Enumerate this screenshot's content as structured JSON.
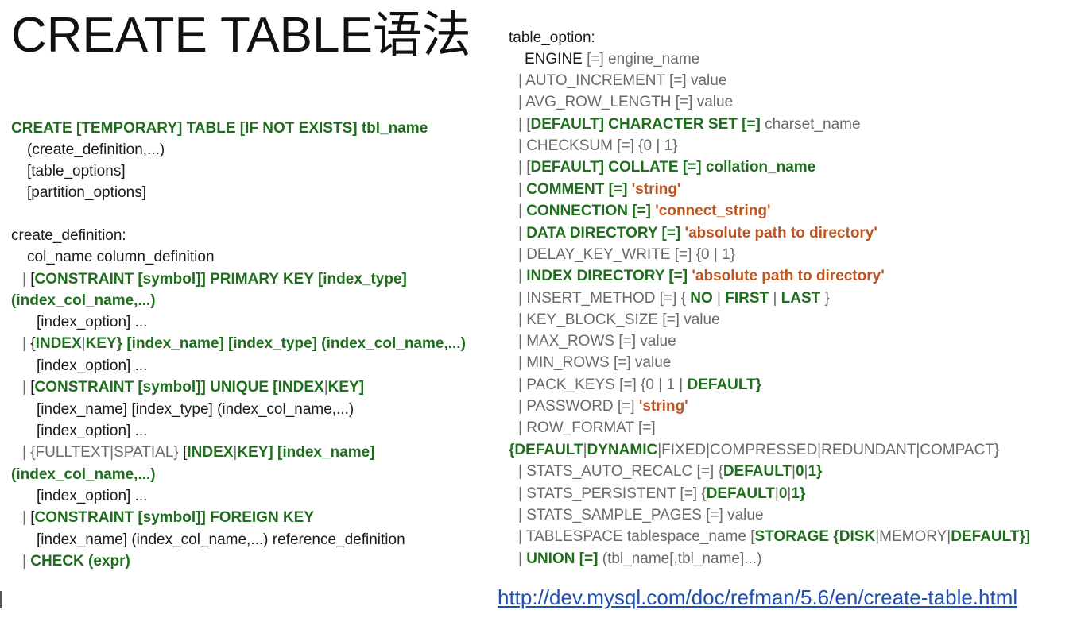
{
  "title": "CREATE TABLE语法",
  "colors": {
    "keyword": "#1e6e1e",
    "option": "#6a6a6a",
    "string": "#c0531e",
    "link": "#1f4fb4"
  },
  "left_lines": [
    [
      [
        "k",
        "CREATE [TEMPORARY] TABLE [IF NOT EXISTS] tbl_name"
      ]
    ],
    [
      [
        "d",
        "(create_definition,...)"
      ]
    ],
    [
      [
        "d",
        "[table_options]"
      ]
    ],
    [
      [
        "d",
        "[partition_options]"
      ]
    ],
    [
      [
        "d",
        "create_definition:"
      ]
    ],
    [
      [
        "d",
        "col_name column_definition"
      ]
    ],
    [
      [
        "g",
        "| "
      ],
      [
        "d",
        "["
      ],
      [
        "k",
        "CONSTRAINT [symbol]] PRIMARY KEY [index_type]"
      ]
    ],
    [
      [
        "k",
        "(index_col_name,...)"
      ]
    ],
    [
      [
        "d",
        "[index_option] ..."
      ]
    ],
    [
      [
        "g",
        "| "
      ],
      [
        "d",
        "{"
      ],
      [
        "k",
        "INDEX"
      ],
      [
        "g",
        "|"
      ],
      [
        "k",
        "KEY} [index_name] [index_type] (index_col_name,...)"
      ]
    ],
    [
      [
        "d",
        "[index_option] ..."
      ]
    ],
    [
      [
        "g",
        "| "
      ],
      [
        "d",
        "["
      ],
      [
        "k",
        "CONSTRAINT [symbol]] UNIQUE [INDEX"
      ],
      [
        "g",
        "|"
      ],
      [
        "k",
        "KEY]"
      ]
    ],
    [
      [
        "d",
        "[index_name] [index_type] (index_col_name,...)"
      ]
    ],
    [
      [
        "d",
        "[index_option] ..."
      ]
    ],
    [
      [
        "g",
        "| {FULLTEXT|SPATIAL} "
      ],
      [
        "d",
        "["
      ],
      [
        "k",
        "INDEX"
      ],
      [
        "g",
        "|"
      ],
      [
        "k",
        "KEY] [index_name]"
      ]
    ],
    [
      [
        "k",
        "(index_col_name,...)"
      ]
    ],
    [
      [
        "d",
        "[index_option] ..."
      ]
    ],
    [
      [
        "g",
        "| "
      ],
      [
        "d",
        "["
      ],
      [
        "k",
        "CONSTRAINT [symbol]] FOREIGN KEY"
      ]
    ],
    [
      [
        "d",
        "[index_name] (index_col_name,...) reference_definition"
      ]
    ],
    [
      [
        "g",
        "| "
      ],
      [
        "k",
        "CHECK (expr)"
      ]
    ]
  ],
  "right_lines": [
    [
      [
        "d",
        "table_option:"
      ]
    ],
    [
      [
        "d",
        "ENGINE "
      ],
      [
        "g",
        "[=] engine_name"
      ]
    ],
    [
      [
        "g",
        "| AUTO_INCREMENT [=] value"
      ]
    ],
    [
      [
        "g",
        "| AVG_ROW_LENGTH [=] value"
      ]
    ],
    [
      [
        "g",
        "| ["
      ],
      [
        "k",
        "DEFAULT] CHARACTER SET [=] "
      ],
      [
        "g",
        "charset_name"
      ]
    ],
    [
      [
        "g",
        "| CHECKSUM [=] {0 | 1}"
      ]
    ],
    [
      [
        "g",
        "| ["
      ],
      [
        "k",
        "DEFAULT] COLLATE [=] collation_name"
      ]
    ],
    [
      [
        "g",
        "| "
      ],
      [
        "k",
        "COMMENT [=] "
      ],
      [
        "o",
        "'string'"
      ]
    ],
    [
      [
        "g",
        "| "
      ],
      [
        "k",
        "CONNECTION [=] "
      ],
      [
        "o",
        "'connect_string'"
      ]
    ],
    [
      [
        "g",
        "| "
      ],
      [
        "k",
        "DATA DIRECTORY [=] "
      ],
      [
        "o",
        "'absolute path to directory'"
      ]
    ],
    [
      [
        "g",
        "| DELAY_KEY_WRITE [=] {0 | 1}"
      ]
    ],
    [
      [
        "g",
        "| "
      ],
      [
        "k",
        "INDEX DIRECTORY [=] "
      ],
      [
        "o",
        "'absolute path to directory'"
      ]
    ],
    [
      [
        "g",
        "| INSERT_METHOD [=] { "
      ],
      [
        "k",
        "NO"
      ],
      [
        "g",
        " | "
      ],
      [
        "k",
        "FIRST"
      ],
      [
        "g",
        " | "
      ],
      [
        "k",
        "LAST"
      ],
      [
        "g",
        " }"
      ]
    ],
    [
      [
        "g",
        "| KEY_BLOCK_SIZE [=] value"
      ]
    ],
    [
      [
        "g",
        "| MAX_ROWS [=] value"
      ]
    ],
    [
      [
        "g",
        "| MIN_ROWS [=] value"
      ]
    ],
    [
      [
        "g",
        "| PACK_KEYS [=] {0 | 1 | "
      ],
      [
        "k",
        "DEFAULT}"
      ]
    ],
    [
      [
        "g",
        "| PASSWORD [=] "
      ],
      [
        "o",
        "'string'"
      ]
    ],
    [
      [
        "g",
        "| ROW_FORMAT [=]"
      ]
    ],
    [
      [
        "k",
        "{DEFAULT"
      ],
      [
        "g",
        "|"
      ],
      [
        "k",
        "DYNAMIC"
      ],
      [
        "g",
        "|FIXED|COMPRESSED|REDUNDANT|COMPACT}"
      ]
    ],
    [
      [
        "g",
        "| STATS_AUTO_RECALC [=] {"
      ],
      [
        "k",
        "DEFAULT"
      ],
      [
        "g",
        "|"
      ],
      [
        "k",
        "0"
      ],
      [
        "g",
        "|"
      ],
      [
        "k",
        "1}"
      ]
    ],
    [
      [
        "g",
        "| STATS_PERSISTENT [=] {"
      ],
      [
        "k",
        "DEFAULT"
      ],
      [
        "g",
        "|"
      ],
      [
        "k",
        "0"
      ],
      [
        "g",
        "|"
      ],
      [
        "k",
        "1}"
      ]
    ],
    [
      [
        "g",
        "| STATS_SAMPLE_PAGES [=] value"
      ]
    ],
    [
      [
        "g",
        "| TABLESPACE tablespace_name ["
      ],
      [
        "k",
        "STORAGE {DISK"
      ],
      [
        "g",
        "|MEMORY|"
      ],
      [
        "k",
        "DEFAULT}]"
      ]
    ],
    [
      [
        "g",
        "| "
      ],
      [
        "k",
        "UNION [=] "
      ],
      [
        "g",
        "(tbl_name[,tbl_name]...)"
      ]
    ]
  ],
  "doc_link": "http://dev.mysql.com/doc/refman/5.6/en/create-table.html"
}
